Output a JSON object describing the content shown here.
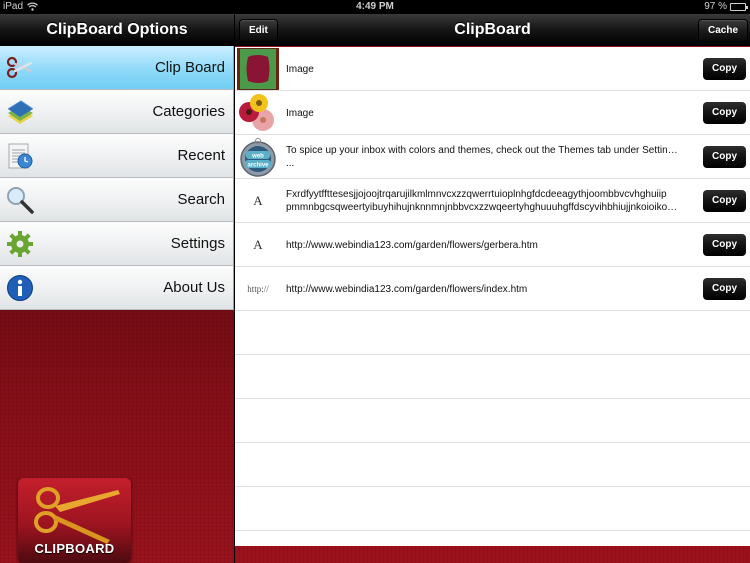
{
  "status_bar": {
    "device": "iPad",
    "time": "4:49 PM",
    "battery": "97 %",
    "battery_level": 0.97
  },
  "left_pane": {
    "title": "ClipBoard Options",
    "menu": [
      {
        "label": "Clip Board",
        "icon": "scissors-icon",
        "active": true
      },
      {
        "label": "Categories",
        "icon": "books-icon",
        "active": false
      },
      {
        "label": "Recent",
        "icon": "clock-notepad-icon",
        "active": false
      },
      {
        "label": "Search",
        "icon": "magnifier-icon",
        "active": false
      },
      {
        "label": "Settings",
        "icon": "gear-icon",
        "active": false
      },
      {
        "label": "About Us",
        "icon": "info-icon",
        "active": false
      }
    ],
    "logo_text": "CLIPBOARD"
  },
  "right_pane": {
    "title": "ClipBoard",
    "edit_label": "Edit",
    "cache_label": "Cache",
    "copy_label": "Copy",
    "items": [
      {
        "type": "image",
        "thumb": "pattern-image-thumb",
        "lines": [
          "Image"
        ]
      },
      {
        "type": "image",
        "thumb": "flowers-image-thumb",
        "lines": [
          "Image"
        ]
      },
      {
        "type": "webarchive",
        "thumb": "web-archive-icon",
        "lines": [
          "To spice up your inbox with colors and themes, check out the Themes tab under Settings.",
          "..."
        ]
      },
      {
        "type": "text",
        "thumb": "A",
        "lines": [
          "Fxrdfyytffttesesjjojoojtrqarujilkmlmnvcxzzqwerrtuioplnhgfdcdeeagythjoombbvcvhghuiip",
          "pmmnbgcsqweertyibuyhihujnknnmnjnbbvcxzzwqeertyhghuuuhgffdscyvihbhiujjnkoioikokk..."
        ]
      },
      {
        "type": "text",
        "thumb": "A",
        "lines": [
          "http://www.webindia123.com/garden/flowers/gerbera.htm"
        ]
      },
      {
        "type": "url",
        "thumb": "http://",
        "lines": [
          "http://www.webindia123.com/garden/flowers/index.htm"
        ]
      }
    ],
    "empty_rows": 5
  }
}
